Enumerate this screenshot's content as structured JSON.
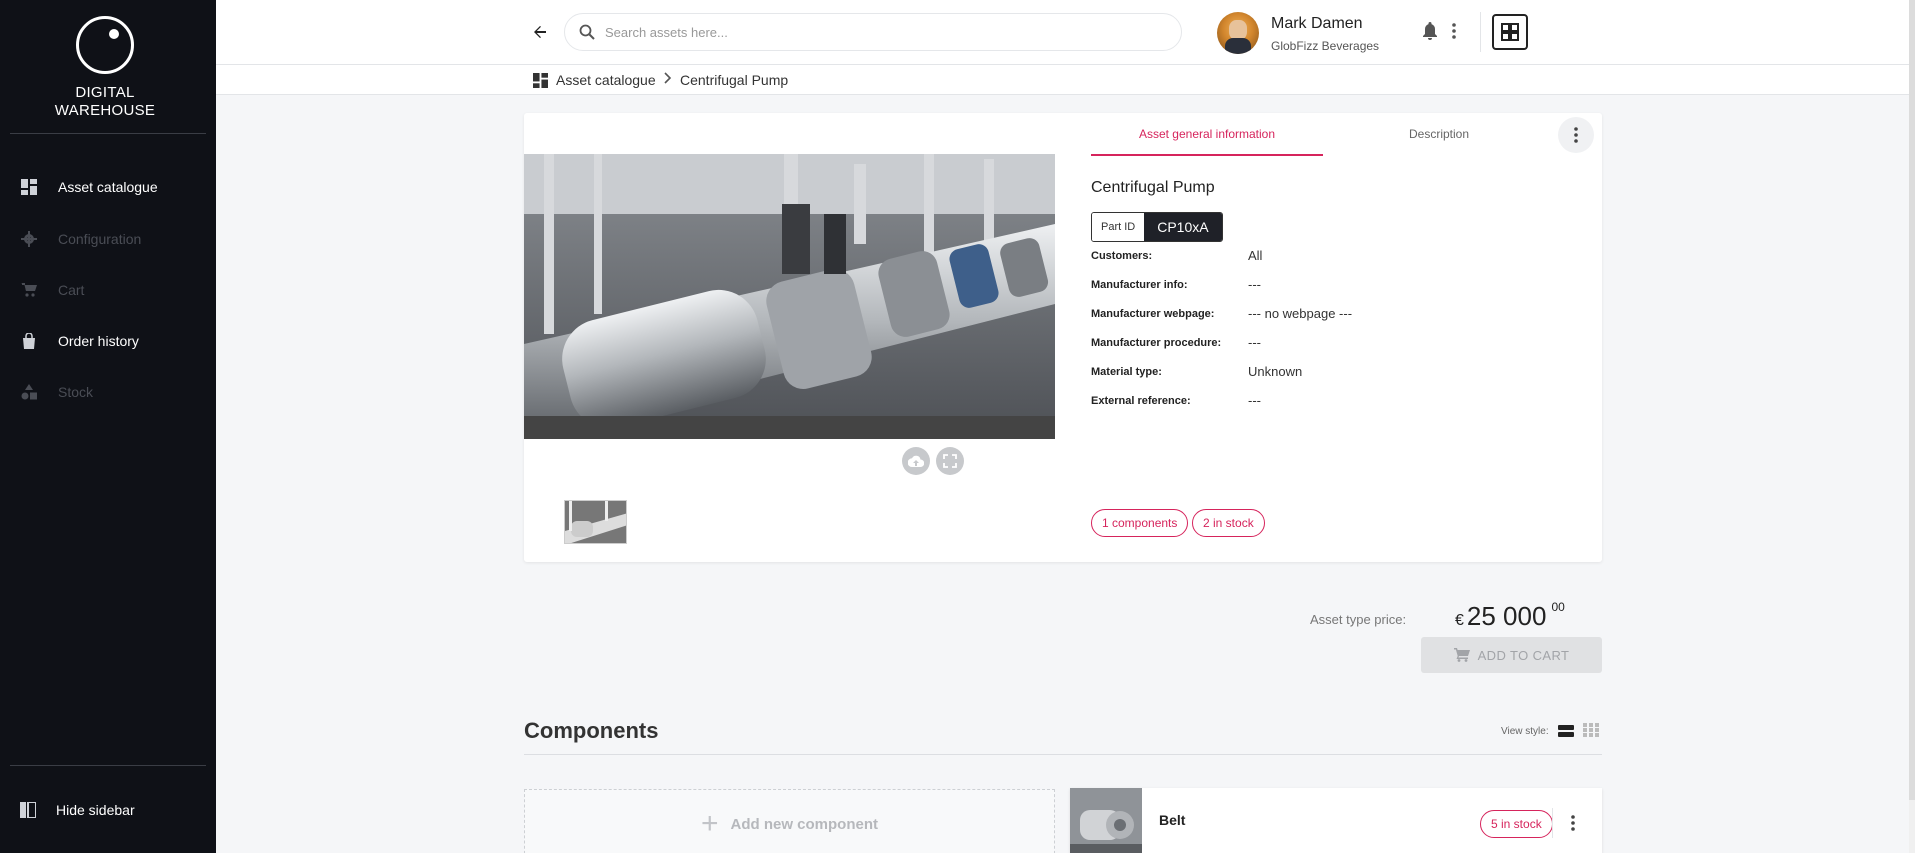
{
  "app": {
    "logo_line1": "DIGITAL",
    "logo_line2": "WAREHOUSE"
  },
  "sidebar": {
    "items": [
      {
        "label": "Asset catalogue",
        "icon": "dashboard-icon",
        "enabled": true
      },
      {
        "label": "Configuration",
        "icon": "gear-icon",
        "enabled": false
      },
      {
        "label": "Cart",
        "icon": "cart-icon",
        "enabled": false
      },
      {
        "label": "Order history",
        "icon": "bag-icon",
        "enabled": true
      },
      {
        "label": "Stock",
        "icon": "shapes-icon",
        "enabled": false
      }
    ],
    "hide_label": "Hide sidebar"
  },
  "topbar": {
    "search_placeholder": "Search assets here...",
    "user_name": "Mark Damen",
    "user_org": "GlobFizz Beverages"
  },
  "breadcrumb": {
    "root": "Asset catalogue",
    "current": "Centrifugal Pump"
  },
  "asset": {
    "tabs": [
      "Asset general information",
      "Description"
    ],
    "active_tab": 0,
    "title": "Centrifugal Pump",
    "part_id_label": "Part ID",
    "part_id": "CP10xA",
    "fields": [
      {
        "key": "Customers:",
        "value": "All"
      },
      {
        "key": "Manufacturer info:",
        "value": "---"
      },
      {
        "key": "Manufacturer webpage:",
        "value": "--- no webpage ---"
      },
      {
        "key": "Manufacturer procedure:",
        "value": "---"
      },
      {
        "key": "Material type:",
        "value": "Unknown"
      },
      {
        "key": "External reference:",
        "value": "---"
      }
    ],
    "components_pill": "1 components",
    "stock_pill": "2 in stock"
  },
  "pricing": {
    "label": "Asset type price:",
    "currency": "€",
    "amount": "25 000",
    "cents": "00",
    "add_to_cart": "ADD TO CART"
  },
  "components": {
    "title": "Components",
    "view_style_label": "View style:",
    "add_label": "Add new component",
    "items": [
      {
        "name": "Belt",
        "stock": "5 in stock"
      }
    ]
  },
  "colors": {
    "accent": "#d6245c",
    "sidebar_bg": "#0f1117"
  }
}
